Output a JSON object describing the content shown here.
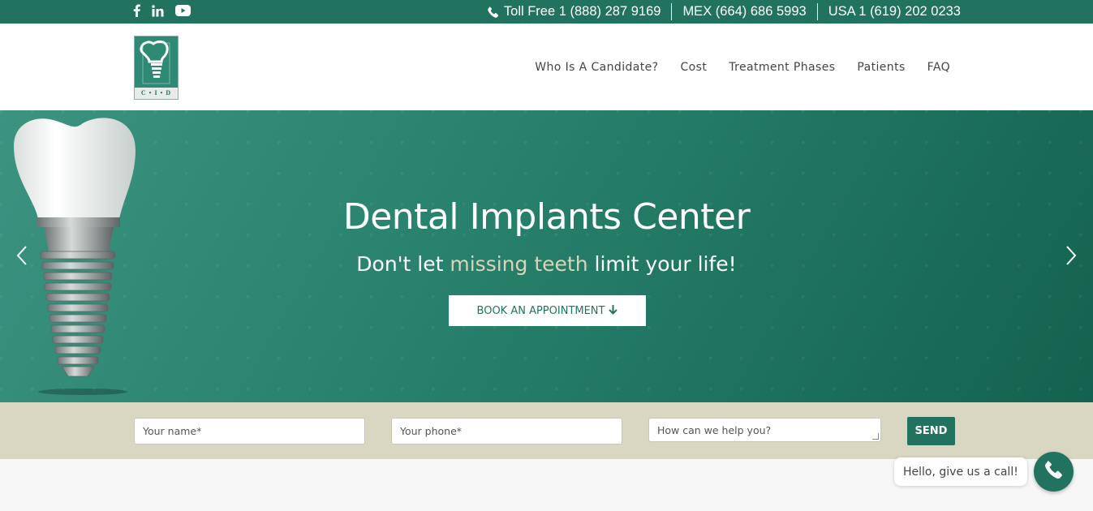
{
  "topbar": {
    "social": [
      {
        "icon": "facebook-icon"
      },
      {
        "icon": "linkedin-icon"
      },
      {
        "icon": "youtube-icon"
      }
    ],
    "contacts": [
      {
        "label": "Toll Free 1 (888) 287 9169",
        "icon": "phone-icon"
      },
      {
        "label": "MEX (664) 686 5993"
      },
      {
        "label": "USA 1 (619) 202 0233"
      }
    ]
  },
  "header": {
    "logo_text": "C • I • D",
    "nav": [
      "Who Is A Candidate?",
      "Cost",
      "Treatment Phases",
      "Patients",
      "FAQ"
    ]
  },
  "hero": {
    "title": "Dental Implants Center",
    "subtitle_pre": "Don't let ",
    "subtitle_highlight": "missing teeth",
    "subtitle_post": " limit your life!",
    "cta_label": "BOOK AN APPOINTMENT",
    "cta_icon": "arrow-down-icon"
  },
  "form": {
    "name_placeholder": "Your name*",
    "phone_placeholder": "Your phone*",
    "message_placeholder": "How can we help you?",
    "send_label": "SEND"
  },
  "call_widget": {
    "bubble_text": "Hello, give us a call!",
    "icon": "phone-icon"
  },
  "colors": {
    "brand_green": "#21735f",
    "highlight": "#d9d3b8",
    "form_bar": "#d9d6c2"
  }
}
